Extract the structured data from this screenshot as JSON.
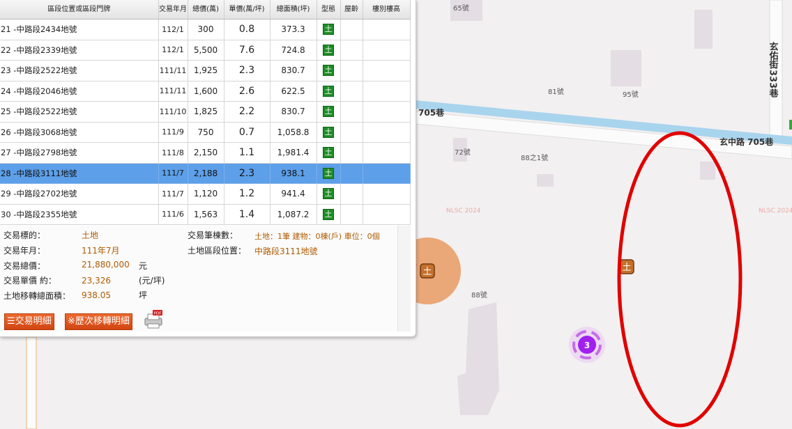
{
  "table": {
    "headers": [
      "區段位置或區段門牌",
      "交易年月",
      "總價(萬)",
      "單價(萬/坪)",
      "總面積(坪)",
      "型態",
      "屋齡",
      "樓別樓高"
    ],
    "rows": [
      {
        "no": "21",
        "addr": "-中路段2434地號",
        "date": "112/1",
        "total": "300",
        "unit": "0.8",
        "area": "373.3",
        "type": "土"
      },
      {
        "no": "22",
        "addr": "-中路段2339地號",
        "date": "112/1",
        "total": "5,500",
        "unit": "7.6",
        "area": "724.8",
        "type": "土"
      },
      {
        "no": "23",
        "addr": "-中路段2522地號",
        "date": "111/11",
        "total": "1,925",
        "unit": "2.3",
        "area": "830.7",
        "type": "土"
      },
      {
        "no": "24",
        "addr": "-中路段2046地號",
        "date": "111/11",
        "total": "1,600",
        "unit": "2.6",
        "area": "622.5",
        "type": "土"
      },
      {
        "no": "25",
        "addr": "-中路段2522地號",
        "date": "111/10",
        "total": "1,825",
        "unit": "2.2",
        "area": "830.7",
        "type": "土"
      },
      {
        "no": "26",
        "addr": "-中路段3068地號",
        "date": "111/9",
        "total": "750",
        "unit": "0.7",
        "area": "1,058.8",
        "type": "土"
      },
      {
        "no": "27",
        "addr": "-中路段2798地號",
        "date": "111/8",
        "total": "2,150",
        "unit": "1.1",
        "area": "1,981.4",
        "type": "土"
      },
      {
        "no": "28",
        "addr": "-中路段3111地號",
        "date": "111/7",
        "total": "2,188",
        "unit": "2.3",
        "area": "938.1",
        "type": "土"
      },
      {
        "no": "29",
        "addr": "-中路段2702地號",
        "date": "111/7",
        "total": "1,120",
        "unit": "1.2",
        "area": "941.4",
        "type": "土"
      },
      {
        "no": "30",
        "addr": "-中路段2355地號",
        "date": "111/6",
        "total": "1,563",
        "unit": "1.4",
        "area": "1,087.2",
        "type": "土"
      }
    ],
    "selected_index": 7
  },
  "details": {
    "target_label": "交易標的：",
    "target_value": "土地",
    "date_label": "交易年月：",
    "date_value": "111年7月",
    "total_label": "交易總價：",
    "total_value": "21,880,000",
    "total_unit": "元",
    "unit_label": "交易單價 約：",
    "unit_value": "23,326",
    "unit_unit": "(元/坪)",
    "area_label": "土地移轉總面積：",
    "area_value": "938.05",
    "area_unit": "坪",
    "count_label": "交易筆棟數：",
    "count_value": "土地：1筆 建物：0棟(戶) 車位：0個",
    "loc_label": "土地區段位置：",
    "loc_value": "中路段3111地號"
  },
  "buttons": {
    "detail": "☰交易明細",
    "history": "※歷次移轉明細",
    "pdf_badge": "PDF"
  },
  "map": {
    "road_label_1": "705巷",
    "road_label_2": "玄中路 705巷",
    "road_label_3": "玄佑街",
    "road_label_4": "333巷",
    "parcel_labels": [
      "65號",
      "81號",
      "95號",
      "72號",
      "88之1號",
      "88號"
    ],
    "watermark": "NLSC 2024",
    "marker_glyph": "土",
    "cluster_count": "3"
  },
  "colors": {
    "selected_row": "#5d9fe8",
    "land_icon": "#1e8c26",
    "value_text": "#b05a00",
    "annotation_red": "#e00000",
    "cluster_purple": "#a020f0",
    "river": "#a9d4ee"
  }
}
